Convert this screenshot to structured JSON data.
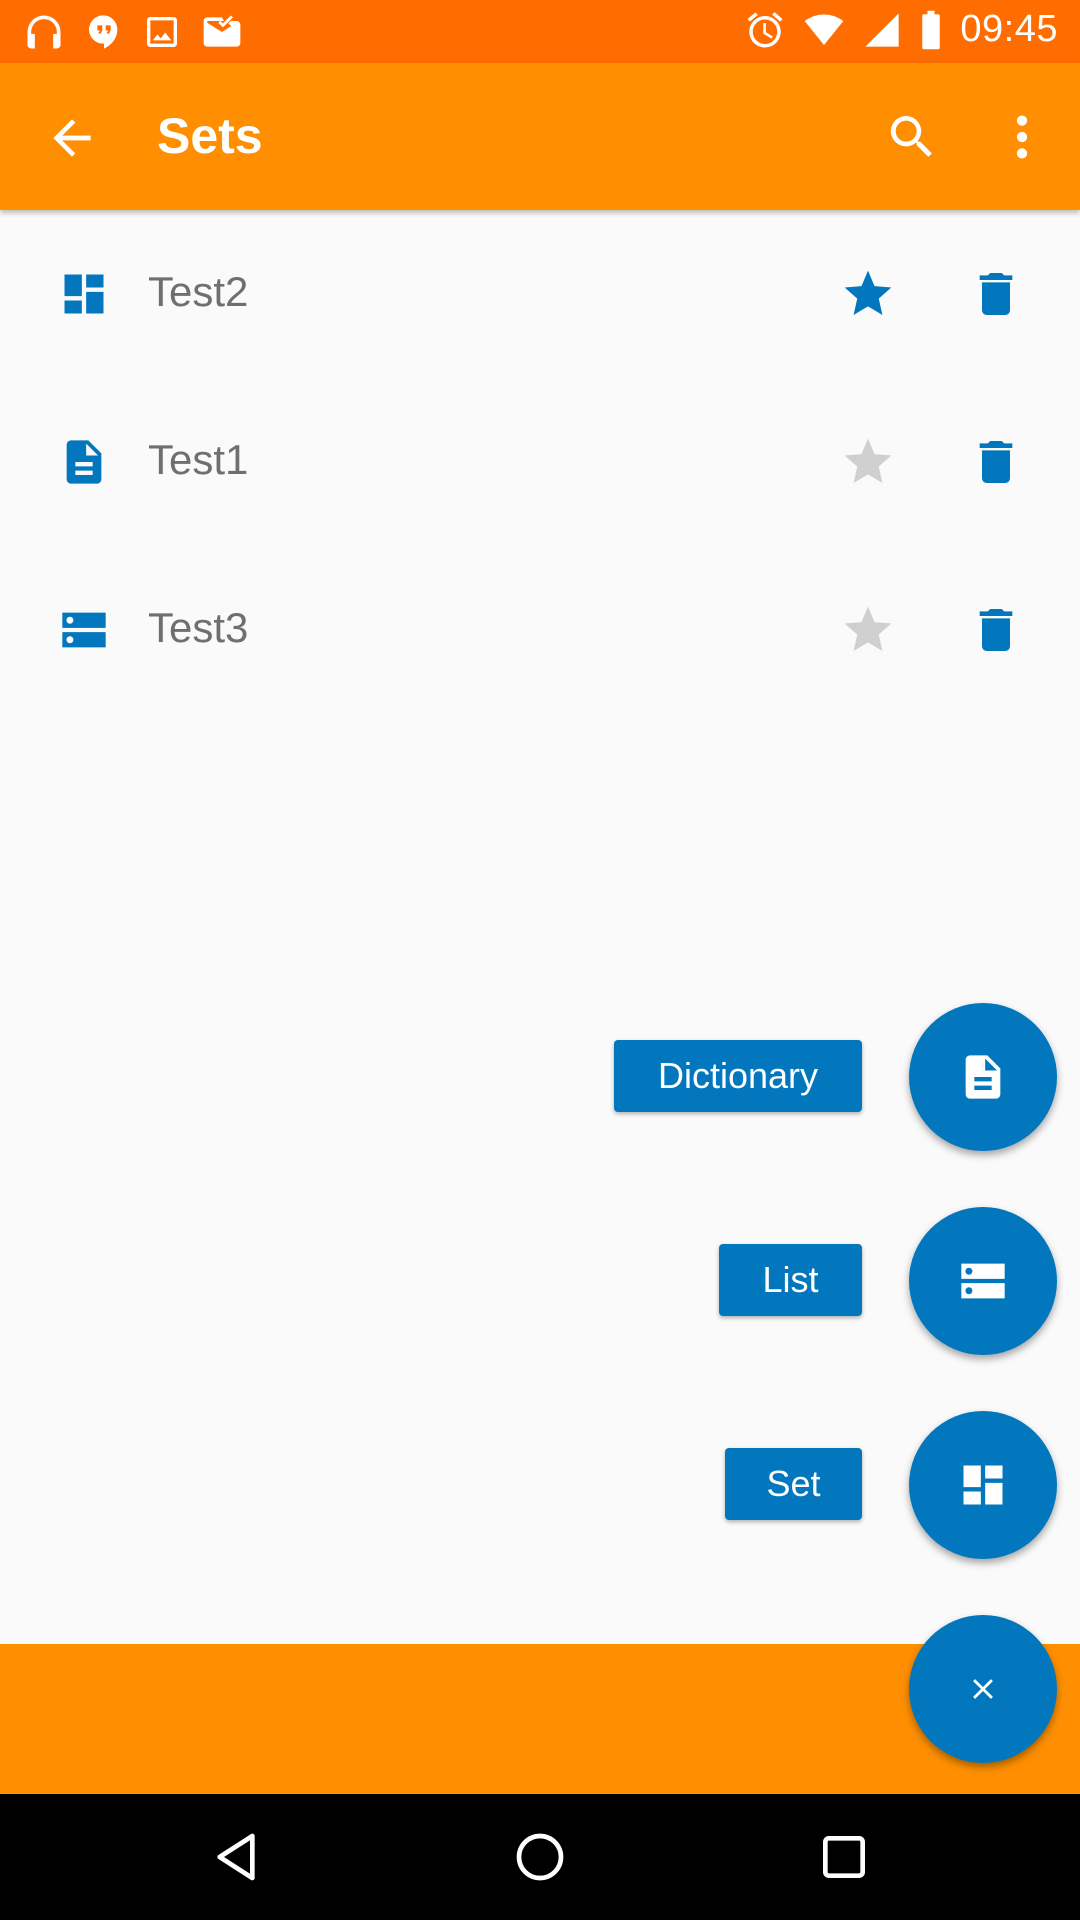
{
  "status_bar": {
    "time": "09:45",
    "left_icons": [
      "headphones-icon",
      "hangouts-icon",
      "image-icon",
      "mail-check-icon"
    ],
    "right_icons": [
      "alarm-icon",
      "wifi-icon",
      "signal-icon",
      "battery-icon"
    ]
  },
  "app_bar": {
    "title": "Sets",
    "background": "#ff8f00"
  },
  "items": [
    {
      "label": "Test2",
      "type_icon": "dashboard-icon",
      "starred": true
    },
    {
      "label": "Test1",
      "type_icon": "document-icon",
      "starred": false
    },
    {
      "label": "Test3",
      "type_icon": "list-icon",
      "starred": false
    }
  ],
  "fab_menu": {
    "options": [
      {
        "label": "Dictionary",
        "icon": "document-icon"
      },
      {
        "label": "List",
        "icon": "list-icon"
      },
      {
        "label": "Set",
        "icon": "dashboard-icon"
      }
    ],
    "close_icon": "close-icon"
  },
  "colors": {
    "accent": "#0277bd",
    "status_bar": "#ff6d00",
    "star_inactive": "#cfcfcf"
  }
}
